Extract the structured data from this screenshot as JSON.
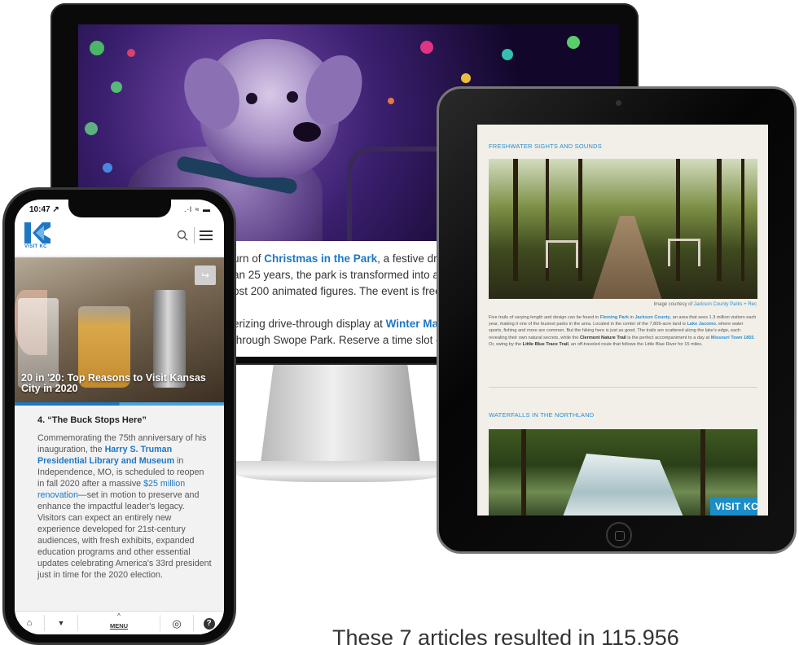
{
  "desktop": {
    "paragraph1_prefix": "urn of ",
    "paragraph1_link": "Christmas in the Park",
    "paragraph1_suffix": ", a festive drive",
    "paragraph1_line2": "an 25 years, the park is transformed into a de",
    "paragraph1_line3": "ost 200 animated figures. The event is free,",
    "paragraph2_prefix": "erizing drive-through display at ",
    "paragraph2_link": "Winter Magic",
    "paragraph2_line2": " through Swope Park. Reserve a time slot or"
  },
  "tablet": {
    "section1_heading": "FRESHWATER SIGHTS AND SOUNDS",
    "caption_prefix": "Image courtesy of ",
    "caption_link": "Jackson County Parks + Rec",
    "body": {
      "t1": "Five trails of varying length and design can be found in ",
      "l1": "Fleming Park",
      "t2": " in ",
      "l2": "Jackson County",
      "t3": ", an area that sees 1.3 million visitors each year, making it one of the busiest parks in the area. Located in the center of the 7,809-acre land is ",
      "l3": "Lake Jacomo",
      "t4": ", where water sports, fishing and more are common. But the hiking here is just as good. The trails are scattered along the lake's edge, each revealing their own natural secrets, while the ",
      "l4": "Clermont Nature Trail",
      "t5": " is the perfect accompaniment to a day at ",
      "l5": "Missouri Town 1855",
      "t6": ". Or, swing by the ",
      "l6": "Little Blue Trace Trail",
      "t7": ", an off-traveled route that follows the Little Blue River for 15 miles."
    },
    "section2_heading": "WATERFALLS IN THE NORTHLAND",
    "badge_text": "VISIT KC"
  },
  "phone": {
    "status_time": "10:47 ↗",
    "status_icons": ".∙l ≈ ▬",
    "logo_text": "VISIT KC",
    "hero_title": "20 in '20: Top Reasons to Visit Kansas City in 2020",
    "item_title": "4. “The Buck Stops Here”",
    "body": {
      "t1": "Commemorating the 75th anniversary of his inauguration, the ",
      "l1": "Harry S. Truman Presidential Library and Museum",
      "t2": " in Independence, MO, is scheduled to reopen in fall 2020 after a massive ",
      "l2": "$25 million renovation",
      "t3": "—set in motion to preserve and enhance the impactful leader's legacy. Visitors can expect an entirely new experience developed for 21st-century audiences, with fresh exhibits, expanded education programs and other essential updates celebrating America's 33rd president just in time for the 2020 election."
    },
    "tabbar": {
      "home": "⌂",
      "location": "▼",
      "menu_caret": "^",
      "menu_label": "MENU",
      "globe": "◎",
      "help": "?"
    }
  },
  "caption": {
    "text": "These 7 articles resulted in 115,956"
  },
  "colors": {
    "link_blue": "#1f77c4",
    "tablet_heading_blue": "#2b8fcf",
    "badge_blue": "#1b8ec7"
  }
}
